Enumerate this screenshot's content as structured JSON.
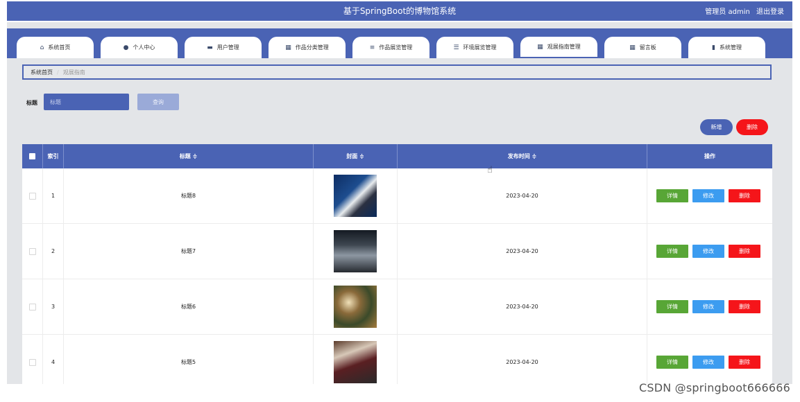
{
  "app": {
    "title": "基于SpringBoot的博物馆系统",
    "role": "管理员 admin",
    "logout": "退出登录"
  },
  "nav": {
    "tabs": [
      {
        "label": "系统首页",
        "icon": "home-icon",
        "glyph": "⌂"
      },
      {
        "label": "个人中心",
        "icon": "user-icon",
        "glyph": "●"
      },
      {
        "label": "用户管理",
        "icon": "briefcase-icon",
        "glyph": "▬"
      },
      {
        "label": "作品分类管理",
        "icon": "grid-icon",
        "glyph": "▦"
      },
      {
        "label": "作品展览管理",
        "icon": "list-icon",
        "glyph": "≡"
      },
      {
        "label": "环境展览管理",
        "icon": "sliders-icon",
        "glyph": "☰"
      },
      {
        "label": "观展指南管理",
        "icon": "grid-icon",
        "glyph": "▦"
      },
      {
        "label": "留言板",
        "icon": "grid-icon",
        "glyph": "▦"
      },
      {
        "label": "系统管理",
        "icon": "chart-icon",
        "glyph": "▮"
      }
    ],
    "active_index": 6
  },
  "breadcrumb": {
    "home": "系统首页",
    "current": "观展指南"
  },
  "search": {
    "label": "标题",
    "placeholder": "标题",
    "button": "查询"
  },
  "actions": {
    "add": "新增",
    "delete": "删除"
  },
  "table": {
    "headers": {
      "index": "索引",
      "title": "标题 ≑",
      "cover": "封面 ≑",
      "date": "发布时间 ≑",
      "ops": "操作"
    },
    "row_buttons": {
      "detail": "详情",
      "edit": "修改",
      "delete": "删除"
    },
    "rows": [
      {
        "index": "1",
        "title": "标题8",
        "date": "2023-04-20"
      },
      {
        "index": "2",
        "title": "标题7",
        "date": "2023-04-20"
      },
      {
        "index": "3",
        "title": "标题6",
        "date": "2023-04-20"
      },
      {
        "index": "4",
        "title": "标题5",
        "date": "2023-04-20"
      }
    ]
  },
  "watermark": "CSDN @springboot666666",
  "colors": {
    "primary": "#4a63b4",
    "detail": "#58a636",
    "edit": "#3c9cf0",
    "danger": "#f5151a",
    "background": "#e3e5e8"
  }
}
